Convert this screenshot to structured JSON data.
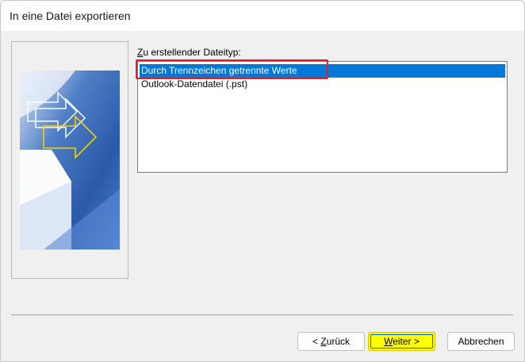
{
  "window": {
    "title": "In eine Datei exportieren"
  },
  "main": {
    "list_label_prefix": "Z",
    "list_label_rest": "u erstellender Dateityp:",
    "list_items": [
      {
        "label": "Durch Trennzeichen getrennte Werte",
        "selected": true
      },
      {
        "label": "Outlook-Datendatei (.pst)",
        "selected": false
      }
    ]
  },
  "buttons": {
    "back_prefix": "< ",
    "back_accel": "Z",
    "back_rest": "urück",
    "next_accel": "W",
    "next_rest": "eiter >",
    "cancel": "Abbrechen"
  },
  "colors": {
    "selection": "#0078d7",
    "annotation_box": "#e0202a",
    "highlight": "#ffff00",
    "graphic_blue": "#2a5aa8"
  },
  "icons": {
    "wizard_graphic": "export-arrows-graphic"
  }
}
